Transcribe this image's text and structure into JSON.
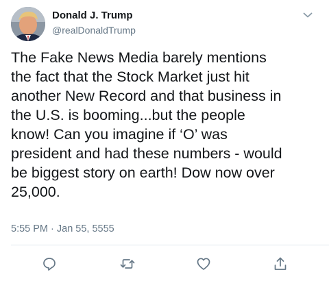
{
  "tweet": {
    "display_name": "Donald J. Trump",
    "handle": "@realDonaldTrump",
    "text_lines": [
      "The Fake News Media barely mentions",
      "the fact that the Stock Market just hit",
      "another New Record and that business in",
      "the U.S. is booming...but the people",
      "know! Can you imagine if ‘O’ was",
      "president and had these numbers - would",
      "be biggest story on earth! Dow now over",
      "25,000."
    ],
    "timestamp": "5:55 PM · Jan 55, 5555"
  },
  "icons": {
    "avatar": "profile-photo",
    "menu": "chevron-down-icon",
    "reply": "reply-icon",
    "retweet": "retweet-icon",
    "like": "heart-icon",
    "share": "share-icon"
  },
  "colors": {
    "text": "#14171a",
    "secondary": "#657786",
    "icon": "#657786",
    "divider": "#e1e8ed"
  }
}
